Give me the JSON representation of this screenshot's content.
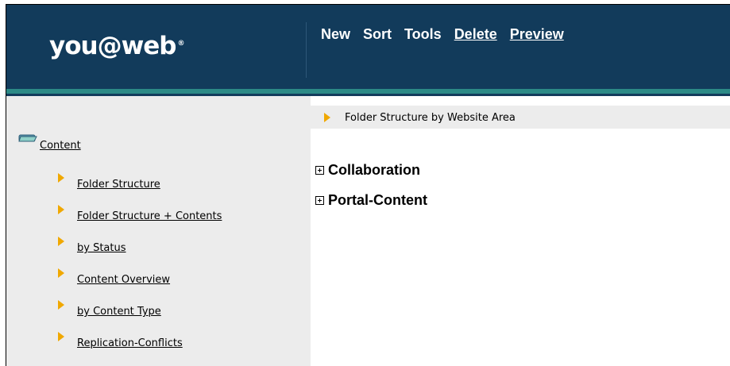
{
  "header": {
    "logo": "you@web",
    "logo_mark": "®",
    "nav": [
      {
        "label": "New",
        "underlined": false
      },
      {
        "label": "Sort",
        "underlined": false
      },
      {
        "label": "Tools",
        "underlined": false
      },
      {
        "label": "Delete",
        "underlined": true
      },
      {
        "label": "Preview",
        "underlined": true
      }
    ]
  },
  "sidebar": {
    "root_label": "Content",
    "root_icon": "folder-icon",
    "items": [
      {
        "label": "Folder Structure",
        "icon": "arrow-right-icon"
      },
      {
        "label": "Folder Structure + Contents",
        "icon": "arrow-right-icon"
      },
      {
        "label": "by Status",
        "icon": "arrow-right-icon"
      },
      {
        "label": "Content Overview",
        "icon": "arrow-right-icon"
      },
      {
        "label": "by Content Type",
        "icon": "arrow-right-icon"
      },
      {
        "label": "Replication-Conflicts",
        "icon": "arrow-right-icon"
      }
    ]
  },
  "main": {
    "heading": "Folder Structure by Website Area",
    "tree": [
      {
        "label": "Collaboration",
        "icon": "expand-plus-icon"
      },
      {
        "label": "Portal-Content",
        "icon": "expand-plus-icon"
      }
    ]
  },
  "colors": {
    "header_bg": "#123b5b",
    "accent_teal": "#2c8a86",
    "arrow": "#f0a800",
    "panel_bg": "#ececec"
  }
}
